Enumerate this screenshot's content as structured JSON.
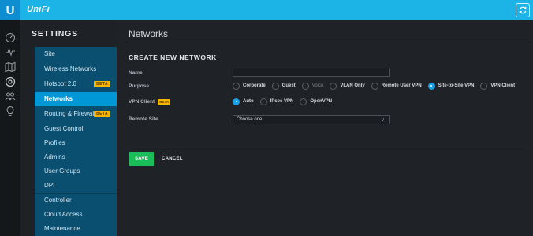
{
  "topbar": {
    "logo_letter": "U",
    "brand": "UniFi",
    "refresh_icon": "refresh-icon"
  },
  "rail": {
    "icons": [
      "dashboard-icon",
      "statistics-icon",
      "map-icon",
      "devices-icon",
      "clients-icon",
      "insights-icon"
    ]
  },
  "settings": {
    "title": "SETTINGS",
    "menu": [
      {
        "label": "Site"
      },
      {
        "label": "Wireless Networks"
      },
      {
        "label": "Hotspot 2.0",
        "badge": "BETA"
      },
      {
        "label": "Networks",
        "active": true
      },
      {
        "label": "Routing & Firewall",
        "badge": "BETA"
      },
      {
        "label": "Guest Control"
      },
      {
        "label": "Profiles"
      },
      {
        "label": "Admins"
      },
      {
        "label": "User Groups"
      },
      {
        "label": "DPI"
      },
      {
        "label": "Controller"
      },
      {
        "label": "Cloud Access"
      },
      {
        "label": "Maintenance"
      }
    ]
  },
  "main": {
    "title": "Networks",
    "section_title": "CREATE NEW NETWORK",
    "name_label": "Name",
    "name_value": "",
    "purpose_label": "Purpose",
    "purpose_options": [
      {
        "label": "Corporate",
        "checked": false,
        "disabled": false
      },
      {
        "label": "Guest",
        "checked": false,
        "disabled": false
      },
      {
        "label": "Voice",
        "checked": false,
        "disabled": true
      },
      {
        "label": "VLAN Only",
        "checked": false,
        "disabled": false
      },
      {
        "label": "Remote User VPN",
        "checked": false,
        "disabled": false
      },
      {
        "label": "Site-to-Site VPN",
        "checked": true,
        "disabled": false
      },
      {
        "label": "VPN Client",
        "checked": false,
        "disabled": false
      }
    ],
    "vpn_client_label": "VPN Client",
    "vpn_client_badge": "BETA",
    "vpn_client_options": [
      {
        "label": "Auto",
        "checked": true
      },
      {
        "label": "IPsec VPN",
        "checked": false
      },
      {
        "label": "OpenVPN",
        "checked": false
      }
    ],
    "remote_site_label": "Remote Site",
    "remote_site_value": "Choose one",
    "save_label": "SAVE",
    "cancel_label": "CANCEL"
  },
  "colors": {
    "topbar": "#1cb3e6",
    "menu_bg": "#0b4f70",
    "menu_active": "#0097d6",
    "radio_checked": "#1a9ee5",
    "save_button": "#1bbd5a",
    "beta_badge": "#f7b500"
  }
}
